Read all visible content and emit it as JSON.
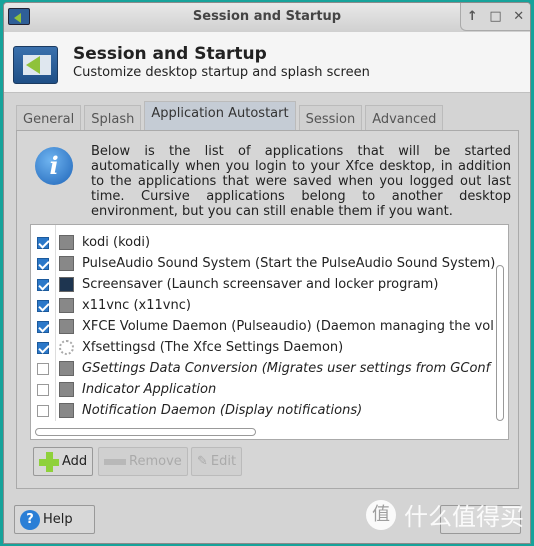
{
  "window": {
    "title": "Session and Startup"
  },
  "header": {
    "title": "Session and Startup",
    "subtitle": "Customize desktop startup and splash screen"
  },
  "tabs": [
    {
      "label": "General"
    },
    {
      "label": "Splash"
    },
    {
      "label": "Application Autostart",
      "active": true
    },
    {
      "label": "Session"
    },
    {
      "label": "Advanced"
    }
  ],
  "info": "Below is the list of applications that will be started automatically when you login to your Xfce desktop, in addition to the applications that were saved when you logged out last time. Cursive applications belong to another desktop environment, but you can still enable them if you want.",
  "apps": [
    {
      "label": "kodi (kodi)",
      "checked": true,
      "icon": "generic-app-icon"
    },
    {
      "label": "PulseAudio Sound System (Start the PulseAudio Sound System)",
      "checked": true,
      "icon": "generic-app-icon"
    },
    {
      "label": "Screensaver (Launch screensaver and locker program)",
      "checked": true,
      "icon": "screensaver-icon"
    },
    {
      "label": "x11vnc (x11vnc)",
      "checked": true,
      "icon": "generic-app-icon"
    },
    {
      "label": "XFCE Volume Daemon (Pulseaudio) (Daemon managing the vol",
      "checked": true,
      "icon": "generic-app-icon"
    },
    {
      "label": "Xfsettingsd (The Xfce Settings Daemon)",
      "checked": true,
      "icon": "gear-icon"
    },
    {
      "label": "GSettings Data Conversion (Migrates user settings from GConf",
      "checked": false,
      "italic": true,
      "icon": "generic-app-icon"
    },
    {
      "label": "Indicator Application",
      "checked": false,
      "italic": true,
      "icon": "generic-app-icon"
    },
    {
      "label": "Notification Daemon (Display notifications)",
      "checked": false,
      "italic": true,
      "icon": "generic-app-icon"
    }
  ],
  "buttons": {
    "add": "Add",
    "remove": "Remove",
    "edit": "Edit",
    "help": "Help"
  },
  "watermark": {
    "logo": "值",
    "text": "什么值得买"
  }
}
